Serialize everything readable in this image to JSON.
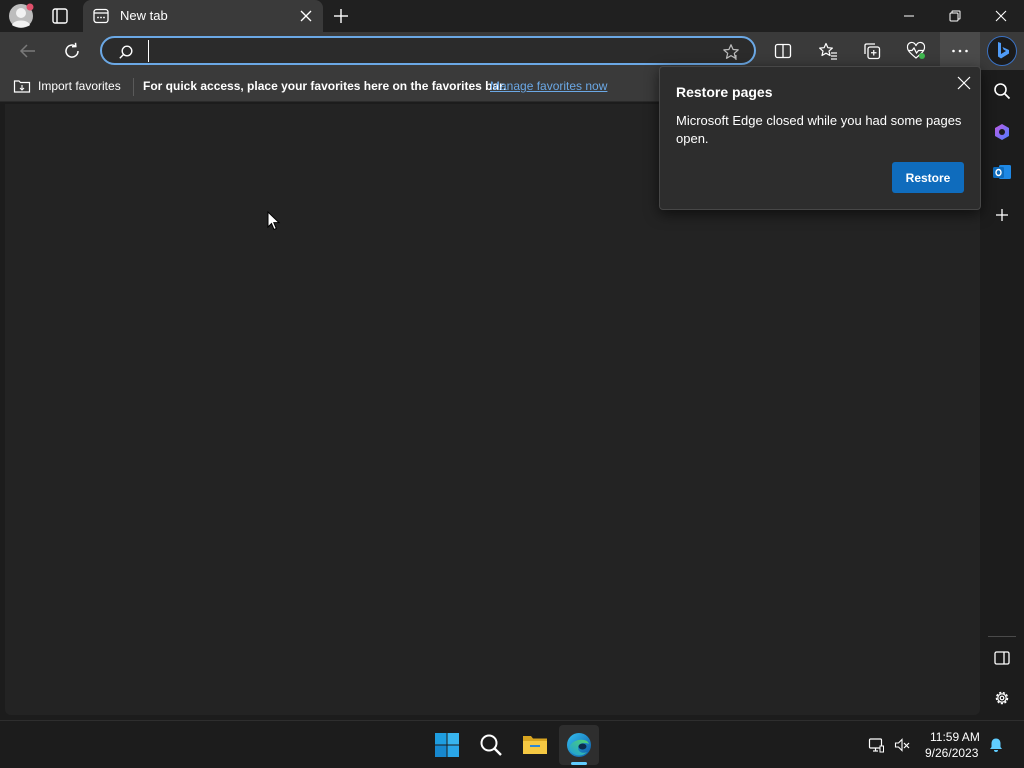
{
  "tab": {
    "title": "New tab"
  },
  "address_bar": {
    "value": "",
    "placeholder": ""
  },
  "favorites_bar": {
    "import_label": "Import favorites",
    "message": "For quick access, place your favorites here on the favorites bar.",
    "manage_link": "Manage favorites now"
  },
  "restore_popup": {
    "title": "Restore pages",
    "body": "Microsoft Edge closed while you had some pages open.",
    "button_label": "Restore"
  },
  "taskbar": {
    "time": "11:59 AM",
    "date": "9/26/2023"
  },
  "colors": {
    "accent": "#0f6cbd",
    "link": "#6ba8e5",
    "taskbar_indicator": "#60cdff"
  }
}
